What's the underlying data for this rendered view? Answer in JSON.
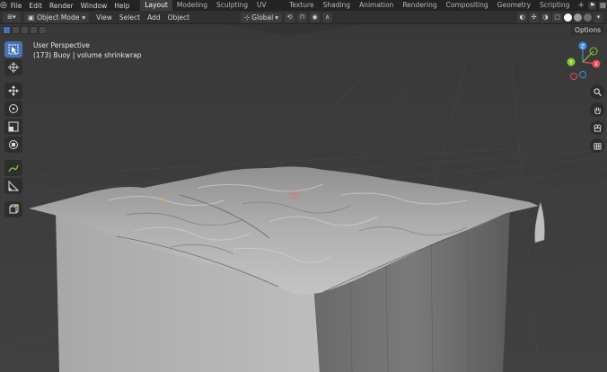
{
  "topbar": {
    "menu": [
      "File",
      "Edit",
      "Render",
      "Window",
      "Help"
    ],
    "tabs": [
      {
        "label": "Layout",
        "active": true
      },
      {
        "label": "Modeling"
      },
      {
        "label": "Sculpting"
      },
      {
        "label": "UV Editing"
      },
      {
        "label": "Texture Paint"
      },
      {
        "label": "Shading"
      },
      {
        "label": "Animation"
      },
      {
        "label": "Rendering"
      },
      {
        "label": "Compositing"
      },
      {
        "label": "Geometry Nodes"
      },
      {
        "label": "Scripting"
      }
    ],
    "add_tab": "+"
  },
  "header": {
    "mode": "Object Mode",
    "menu": [
      "View",
      "Select",
      "Add",
      "Object"
    ],
    "orientation": "Global"
  },
  "viewport": {
    "options": "Options",
    "view_name": "User Perspective",
    "object_info": "(173) Buoy | volume shrinkwrap"
  },
  "gizmo": {
    "axes": [
      "X",
      "Y",
      "Z"
    ],
    "colors": {
      "x": "#e64a5b",
      "y": "#7fcc2c",
      "z": "#3b8fe4"
    }
  },
  "colors": {
    "accent": "#4772b3",
    "viewport_bg": "#3d3d3d",
    "header_bg": "#303030"
  }
}
